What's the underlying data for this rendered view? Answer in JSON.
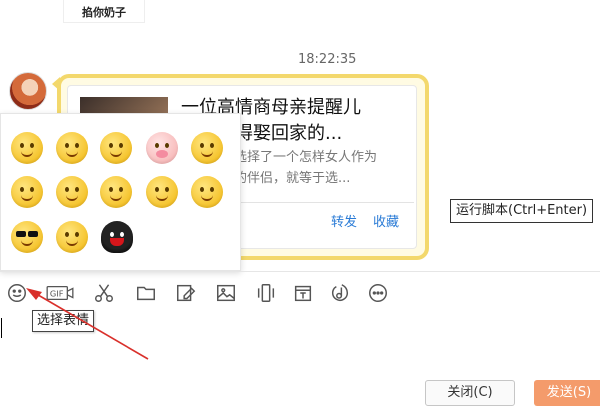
{
  "sticker": {
    "text": "掐你奶子"
  },
  "chat": {
    "timestamp": "18:22:35",
    "card": {
      "title_line1": "一位高情商母亲提醒儿",
      "title_line2": "真正值得娶回家的...",
      "desc_line1": "选择了一个怎样女人作为",
      "desc_line2": "的伴侣，就等于选...",
      "forward_label": "转发",
      "favorite_label": "收藏"
    },
    "bubble_color": "#f3d86c"
  },
  "emoji_panel": {
    "items": [
      "smug-face",
      "shy-face",
      "grin-face",
      "pig-face",
      "embarrassed-face",
      "smile-face",
      "cry-face",
      "happy-face",
      "teeth-grin-face",
      "blush-face",
      "cool-shades-face",
      "thinking-face",
      "qq-penguin-face"
    ]
  },
  "shortcut_hint": "运行脚本(Ctrl+Enter)",
  "toolbar": {
    "icons": [
      "emoji-icon",
      "gif-icon",
      "scissors-icon",
      "folder-icon",
      "image-edit-icon",
      "image-icon",
      "shake-icon",
      "calendar-icon",
      "music-icon",
      "more-icon"
    ],
    "emoji_tooltip": "选择表情",
    "gif_label": "GIF"
  },
  "buttons": {
    "close_label": "关闭(C)",
    "send_label": "发送(S)",
    "send_color": "#f49b6b"
  },
  "annotation_color": "#d9302b"
}
